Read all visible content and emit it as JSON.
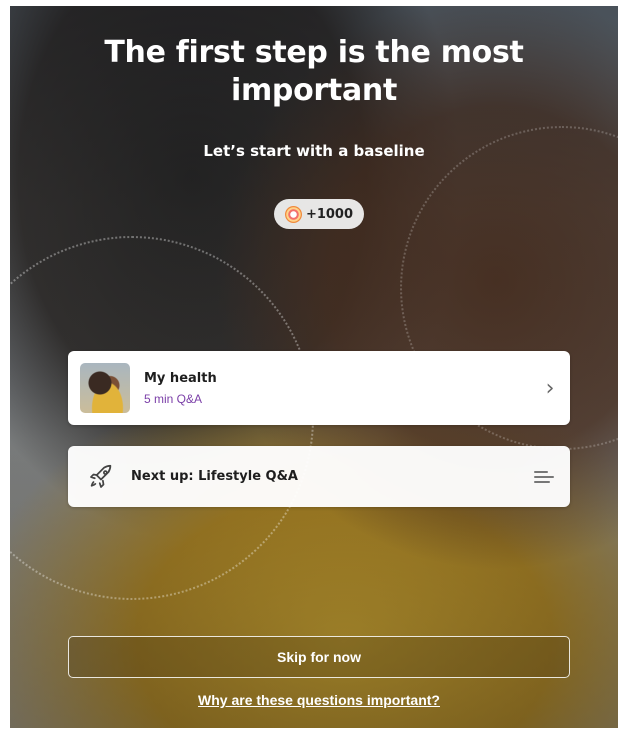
{
  "header": {
    "title": "The first step is the most important",
    "subtitle": "Let’s start with a baseline"
  },
  "reward": {
    "points_label": "+1000",
    "icon": "reward-coin-icon",
    "colors": [
      "#f3706a",
      "#ffd38a",
      "#f08a3c"
    ]
  },
  "cards": {
    "health": {
      "title": "My health",
      "subtitle": "5 min Q&A",
      "subtitle_color": "#7b3fa8",
      "icon": "chevron-right-icon"
    },
    "next": {
      "title": "Next up: Lifestyle Q&A",
      "icon": "rocket-icon",
      "menu_icon": "menu-lines-icon"
    }
  },
  "actions": {
    "skip_label": "Skip for now",
    "why_link": "Why are these questions important?"
  },
  "colors": {
    "accent": "#7b3fa8",
    "card_background": "#ffffff",
    "text": "#ffffff"
  }
}
